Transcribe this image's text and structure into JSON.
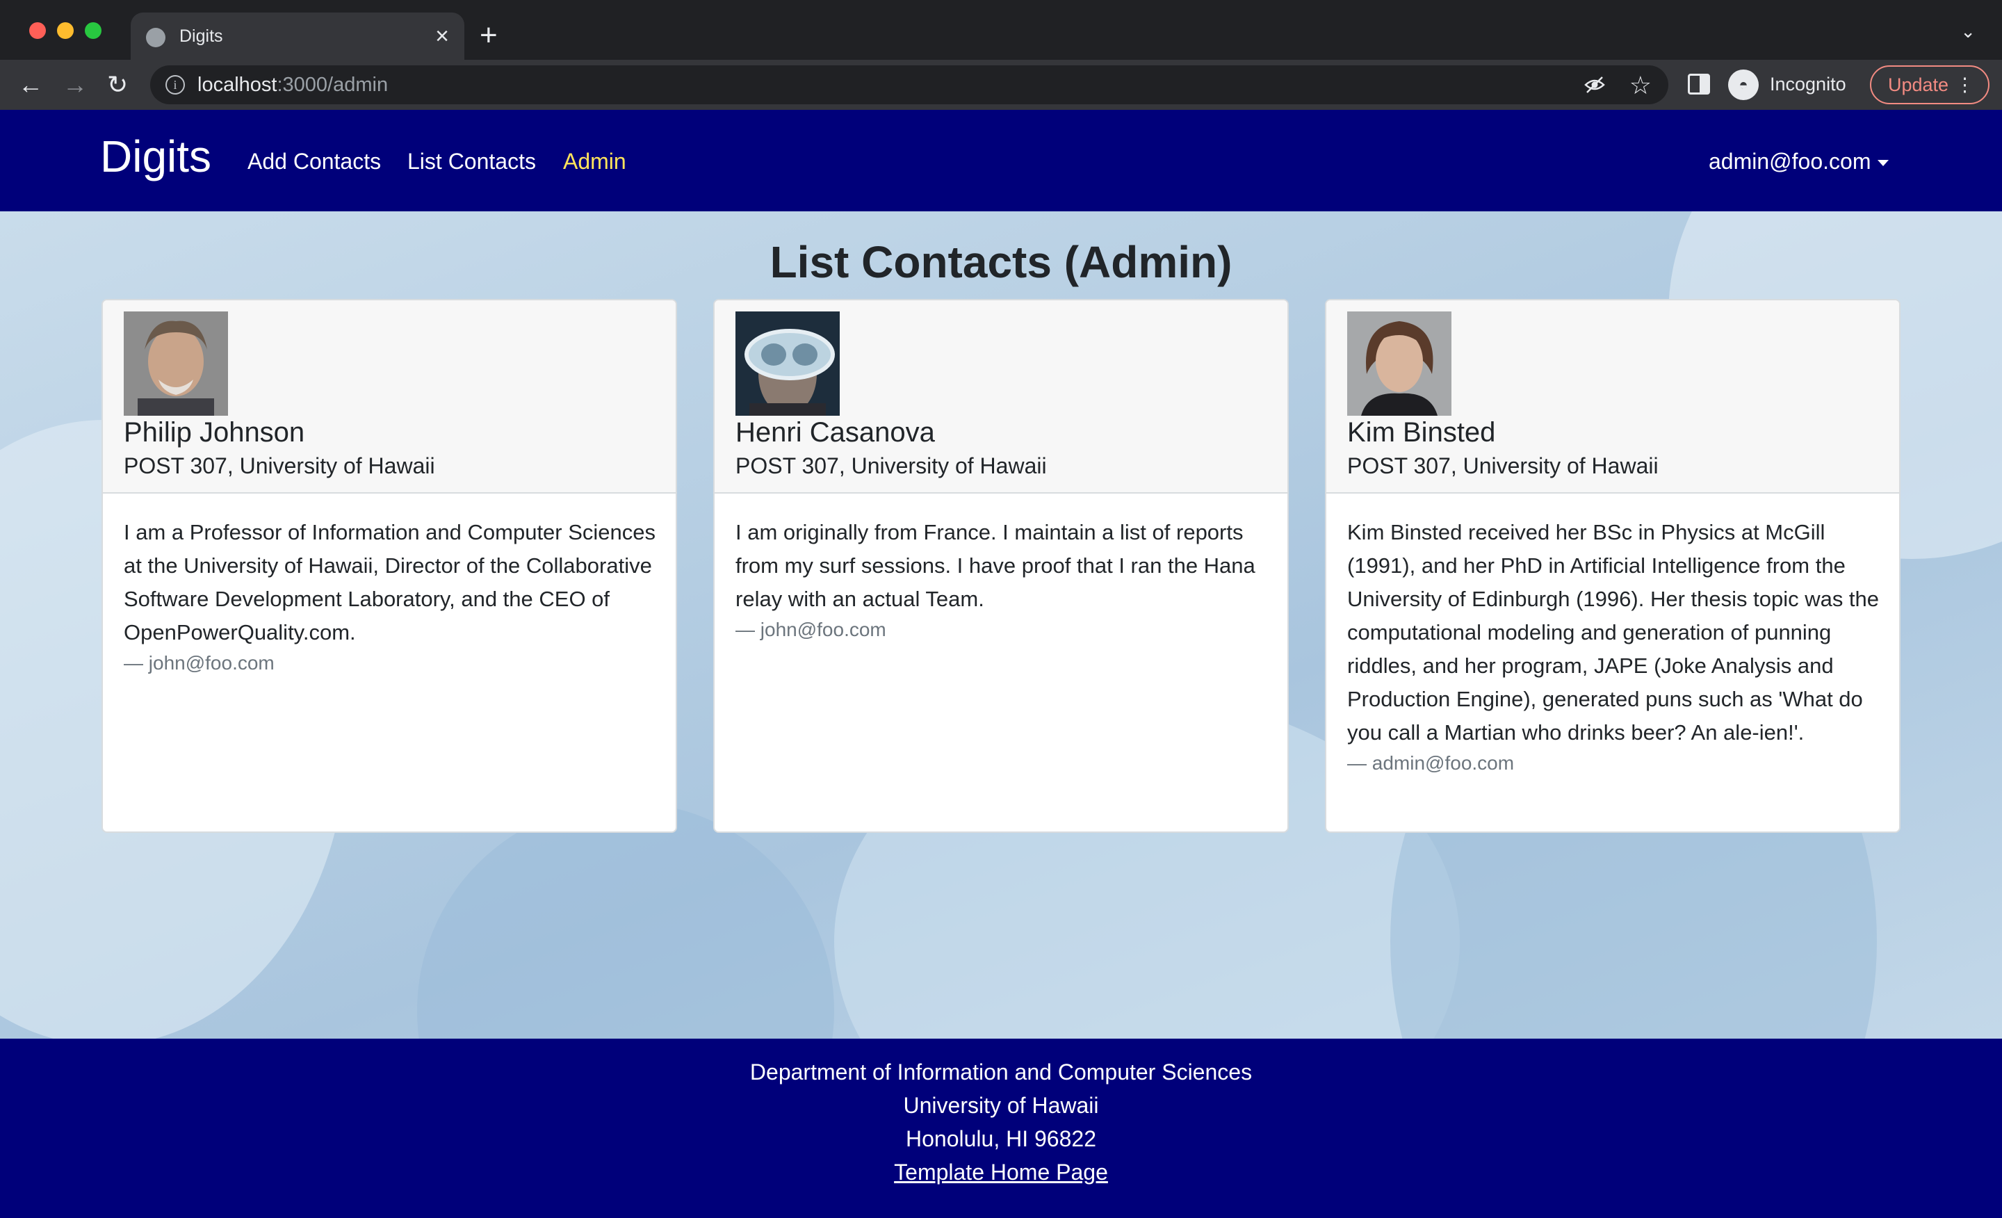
{
  "browser": {
    "tab_title": "Digits",
    "url_host": "localhost",
    "url_path": ":3000/admin",
    "profile_label": "Incognito",
    "update_label": "Update"
  },
  "navbar": {
    "brand": "Digits",
    "links": [
      "Add Contacts",
      "List Contacts",
      "Admin"
    ],
    "active_link": "Admin",
    "user": "admin@foo.com"
  },
  "main": {
    "title": "List Contacts (Admin)",
    "contacts": [
      {
        "name": "Philip Johnson",
        "address": "POST 307, University of Hawaii",
        "description": "I am a Professor of Information and Computer Sciences at the University of Hawaii, Director of the Collaborative Software Development Laboratory, and the CEO of OpenPowerQuality.com.",
        "owner": "— john@foo.com"
      },
      {
        "name": "Henri Casanova",
        "address": "POST 307, University of Hawaii",
        "description": "I am originally from France. I maintain a list of reports from my surf sessions. I have proof that I ran the Hana relay with an actual Team.",
        "owner": "— john@foo.com"
      },
      {
        "name": "Kim Binsted",
        "address": "POST 307, University of Hawaii",
        "description": "Kim Binsted received her BSc in Physics at McGill (1991), and her PhD in Artificial Intelligence from the University of Edinburgh (1996). Her thesis topic was the computational modeling and generation of punning riddles, and her program, JAPE (Joke Analysis and Production Engine), generated puns such as 'What do you call a Martian who drinks beer? An ale-ien!'.",
        "owner": "— admin@foo.com"
      }
    ]
  },
  "footer": {
    "line1": "Department of Information and Computer Sciences",
    "line2": "University of Hawaii",
    "line3": "Honolulu, HI 96822",
    "link": "Template Home Page"
  },
  "colors": {
    "navbar_bg": "#00007a",
    "active_link": "#ffe45c"
  }
}
